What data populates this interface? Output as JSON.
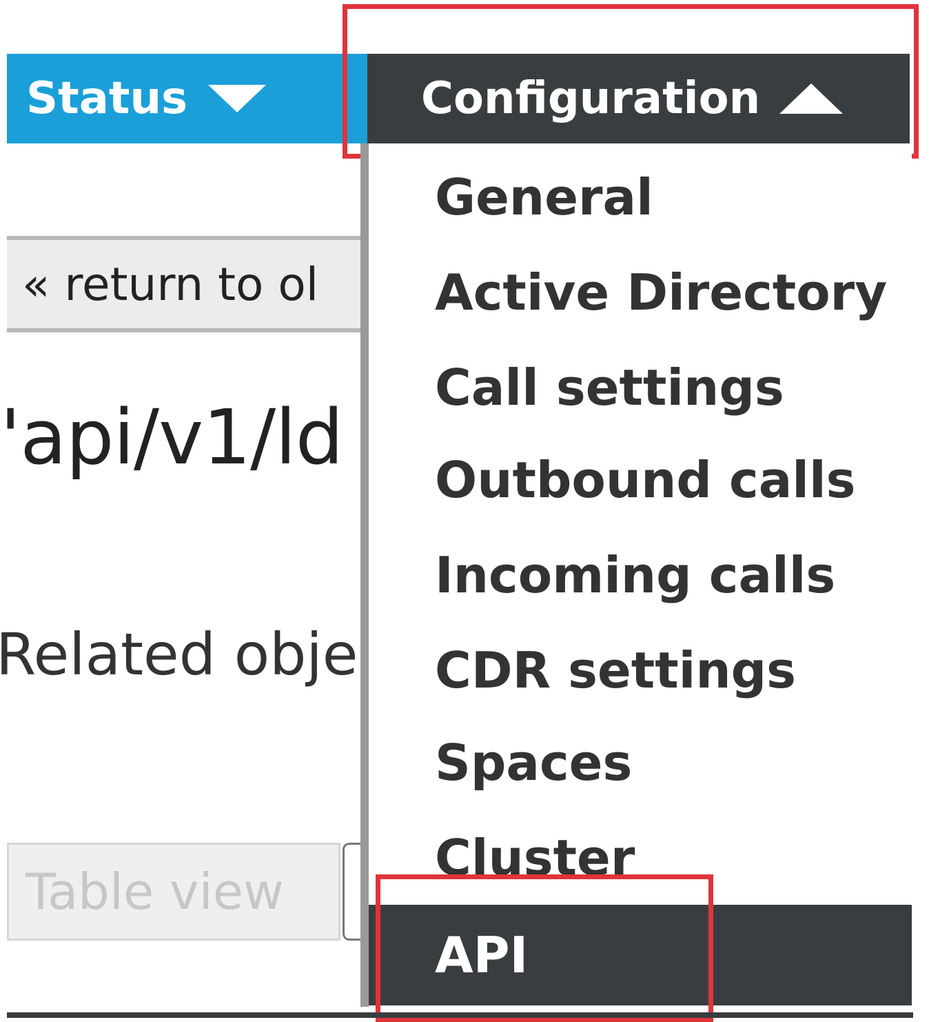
{
  "nav": {
    "status_label": "Status",
    "configuration_label": "Configuration"
  },
  "page": {
    "return_button": "« return to ol",
    "object_path": "'api/v1/ld",
    "related_objects": "Related object",
    "table_view_placeholder": "Table view"
  },
  "config_menu": {
    "items": [
      {
        "label": "General"
      },
      {
        "label": "Active Directory"
      },
      {
        "label": "Call settings"
      },
      {
        "label": "Outbound calls"
      },
      {
        "label": "Incoming calls"
      },
      {
        "label": "CDR settings"
      },
      {
        "label": "Spaces"
      },
      {
        "label": "Cluster"
      },
      {
        "label": "API"
      }
    ],
    "selected": "API"
  },
  "colors": {
    "nav_blue": "#1b9fd9",
    "dark_tab": "#3a3d40",
    "highlight_red": "#e0343c"
  }
}
